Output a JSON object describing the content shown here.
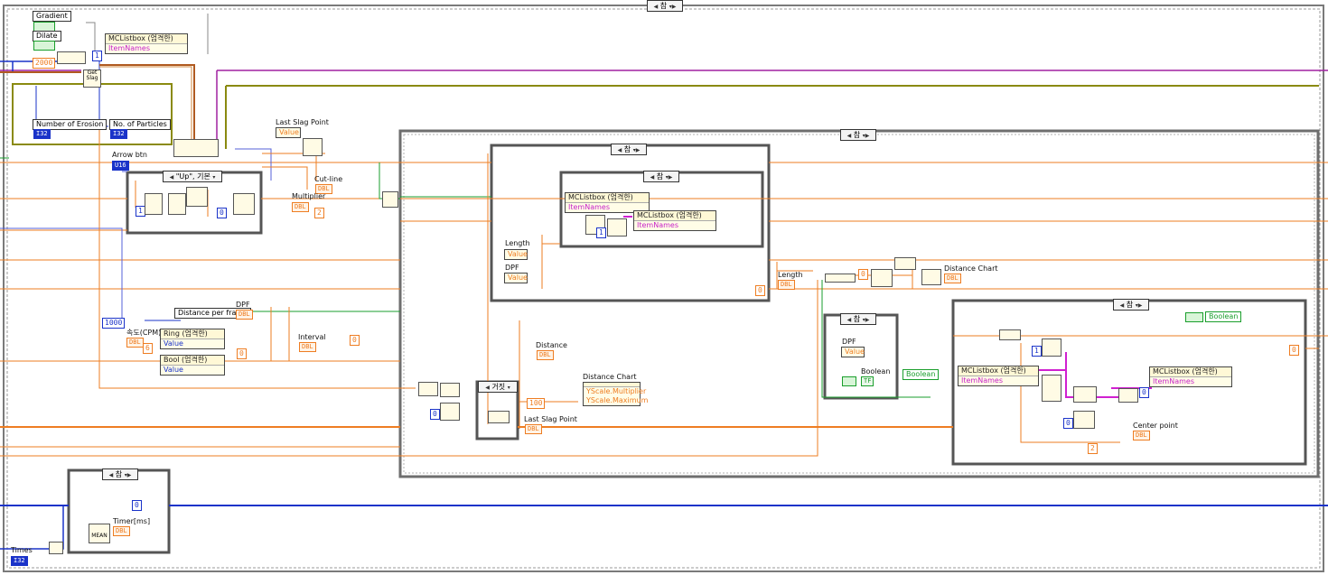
{
  "controls": {
    "gradient": "Gradient",
    "dilate": "Dilate",
    "number_of_erosion": "Number of Erosion",
    "no_of_particles": "No. of Particles",
    "arrow_btn": "Arrow btn",
    "times": "Times",
    "i32_tag": "I32",
    "tf_tag": "TF",
    "dbl_tag": "DBL",
    "u16_tag": "U16"
  },
  "constants": {
    "c2000": "2000",
    "c1": "1",
    "c1000": "1000",
    "c100": "100",
    "c0": "0",
    "c2": "2",
    "c5": "5",
    "c6": "6",
    "get_slag": "Get Slag"
  },
  "case_selectors": {
    "outer": "참",
    "up_case": "\"Up\", 기본",
    "right_main": "참",
    "mid": "참",
    "inner": "참",
    "false_case": "거짓",
    "dpf_case": "참",
    "right_bottom": "참",
    "timer_case": "참"
  },
  "property_nodes": {
    "mclistbox": "MCListbox (엄격한)",
    "itemnames": "ItemNames",
    "ring": "Ring (엄격한)",
    "bool": "Bool (엄격한)",
    "value": "Value"
  },
  "labels": {
    "last_slag_point": "Last Slag Point",
    "cut_line": "Cut-line",
    "multiplier": "Multiplier",
    "distance_per_frame": "Distance per frame",
    "dpf": "DPF",
    "speed_cpm": "속도(CPM)",
    "interval": "Interval",
    "distance": "Distance",
    "distance_chart": "Distance Chart",
    "yscale_multiplier": "YScale.Multiplier",
    "yscale_maximum": "YScale.Maximum",
    "length": "Length",
    "boolean": "Boolean",
    "center_point": "Center point",
    "timer_ms": "Timer[ms]",
    "mean": "MEAN"
  }
}
